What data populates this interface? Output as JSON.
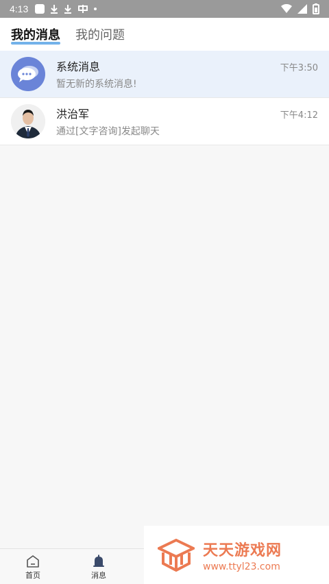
{
  "status_bar": {
    "time": "4:13"
  },
  "header": {
    "tabs": [
      {
        "label": "我的消息",
        "active": true
      },
      {
        "label": "我的问题",
        "active": false
      }
    ]
  },
  "messages": [
    {
      "name": "系统消息",
      "preview": "暂无新的系统消息!",
      "time": "下午3:50",
      "avatar": "chat-bubble-icon"
    },
    {
      "name": "洪治军",
      "preview": "通过[文字咨询]发起聊天",
      "time": "下午4:12",
      "avatar": "person-photo"
    }
  ],
  "bottom_nav": [
    {
      "label": "首页",
      "icon": "home-icon"
    },
    {
      "label": "消息",
      "icon": "bell-icon"
    }
  ],
  "watermark": {
    "title": "天天游戏网",
    "url": "www.ttyl23.com"
  },
  "colors": {
    "accent": "#5aa4e6",
    "system_avatar": "#6a84d8",
    "watermark": "#ec7a52"
  }
}
